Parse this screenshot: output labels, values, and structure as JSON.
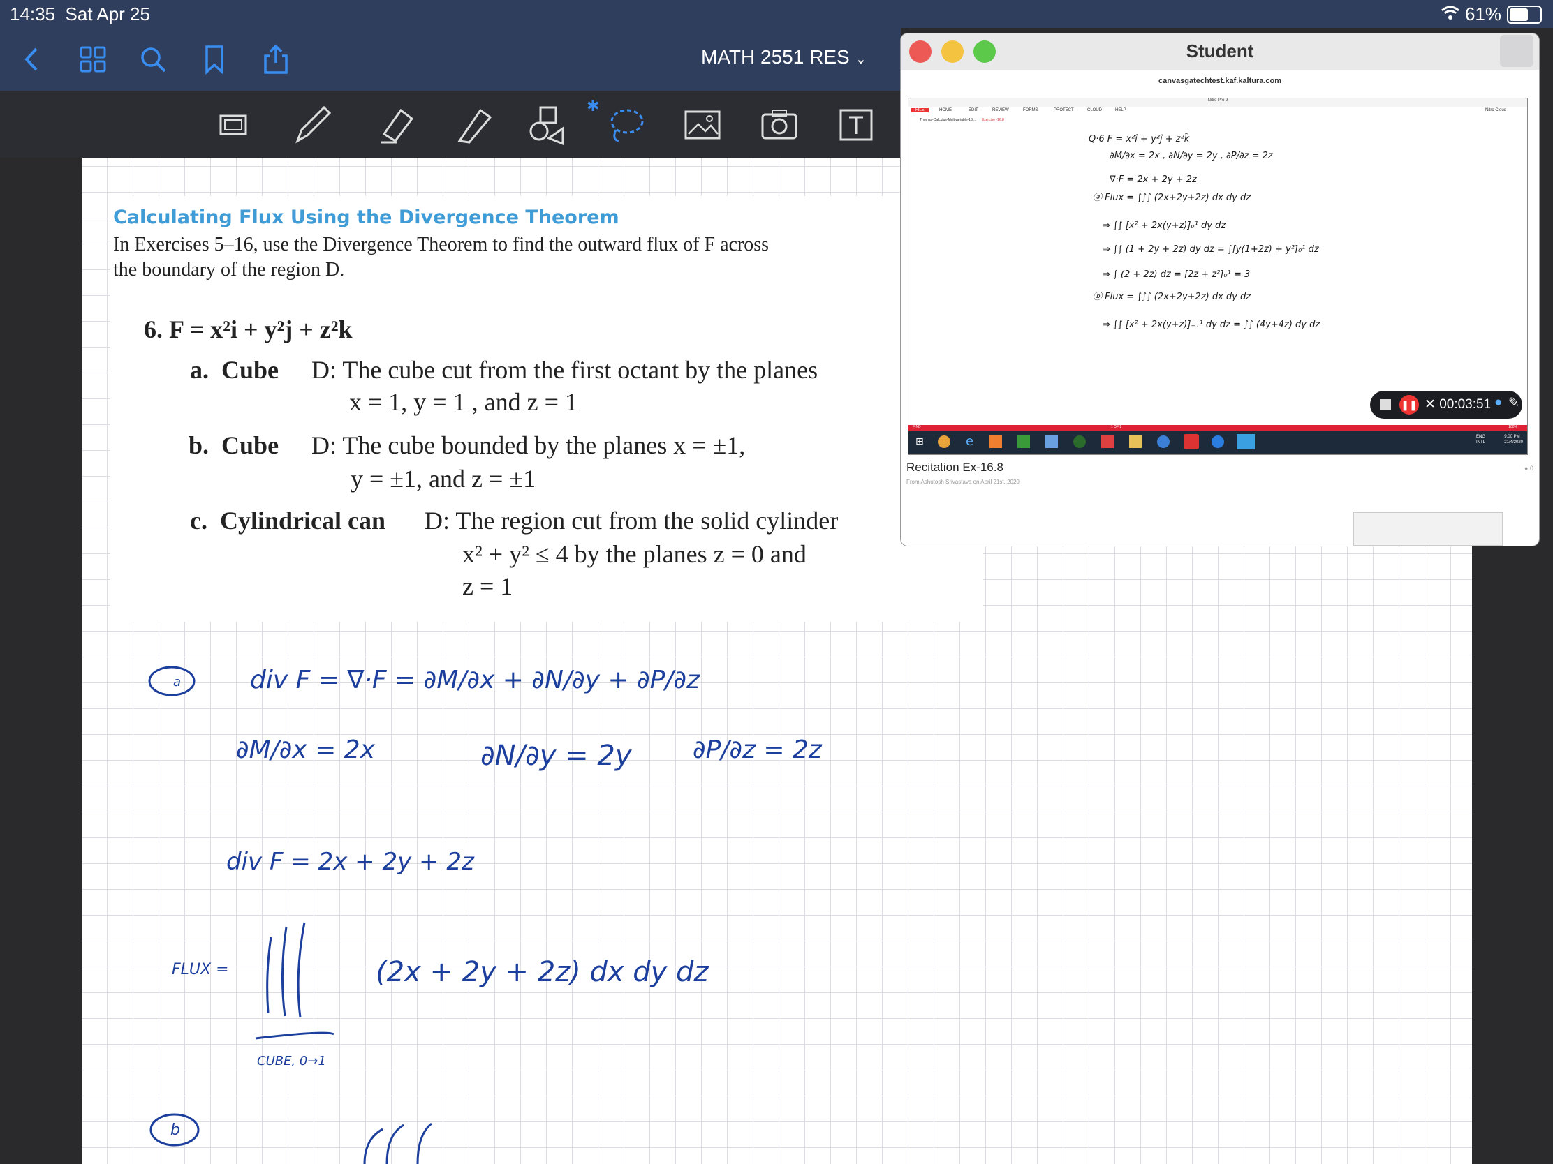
{
  "status_bar": {
    "time": "14:35",
    "date": "Sat Apr 25",
    "battery": "61%"
  },
  "nav": {
    "title": "MATH 2551 RES"
  },
  "content": {
    "heading": "Calculating Flux Using the Divergence Theorem",
    "intro": "In Exercises 5–16, use the Divergence Theorem to find the outward flux of F across the boundary of the region D.",
    "problem_line": "6.  F = x²i + y²j + z²k",
    "parts": [
      {
        "label": "a.",
        "name": "Cube",
        "line1": "D:  The cube cut from the first octant by the planes",
        "line2": "x = 1, y = 1 , and z = 1"
      },
      {
        "label": "b.",
        "name": "Cube",
        "line1": "D:  The cube bounded by the planes x = ±1,",
        "line2": "y = ±1, and z = ±1"
      },
      {
        "label": "c.",
        "name": "Cylindrical can",
        "line1": "D:  The region cut from the solid cylinder",
        "line2": "x² + y² ≤ 4 by the planes z = 0 and",
        "line3": "z = 1"
      }
    ]
  },
  "handwriting": {
    "a_label": "a",
    "line1": "div F =  ∇·F =  ∂M/∂x + ∂N/∂y + ∂P/∂z",
    "line2a": "∂M/∂x = 2x",
    "line2b": "∂N/∂y = 2y",
    "line2c": "∂P/∂z = 2z",
    "line3": "div F = 2x + 2y + 2z",
    "flux_label": "FLUX =",
    "flux_expr": "(2x + 2y + 2z) dx dy dz",
    "cube_note": "CUBE, 0→1",
    "b_label": "b"
  },
  "student_window": {
    "title": "Student",
    "url": "canvasgatechtest.kaf.kaltura.com",
    "app_title": "Nitro Pro 9",
    "menu": [
      "FILE",
      "HOME",
      "EDIT",
      "REVIEW",
      "FORMS",
      "PROTECT",
      "CLOUD",
      "HELP"
    ],
    "tabs": [
      "Thomas-Calculus-Multivariable-13t...",
      "Exercise -16.8"
    ],
    "timer": "00:03:51",
    "video_title": "Recitation Ex-16.8",
    "video_sub": "From Ashutosh Srivastava on April 21st, 2020",
    "comment_count": "0",
    "lang": "ENG",
    "lang2": "INTL",
    "clock": "9:00 PM",
    "clock_date": "21/4/2020",
    "page": "1 OF 2",
    "nitro_cloud": "Nitro Cloud",
    "find": "FIND",
    "zoom": "100%"
  },
  "colors": {
    "ink": "#1c3f9e",
    "heading": "#3f9cd6",
    "bar": "#2f3e5c",
    "toolbar": "#2b2d32"
  }
}
